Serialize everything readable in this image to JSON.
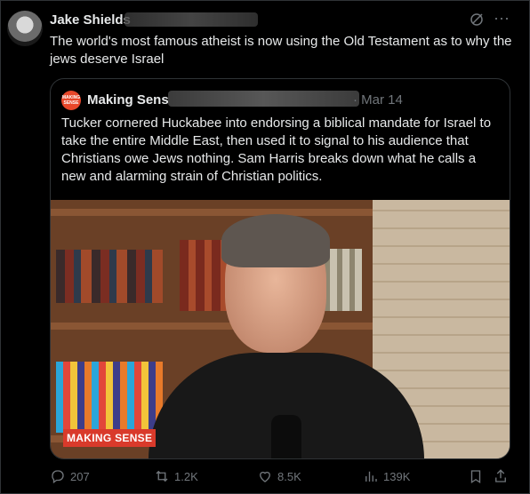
{
  "post": {
    "author_name": "Jake Shields",
    "text": "The world's most famous atheist is now using the Old Testament as to why the jews deserve Israel"
  },
  "quote": {
    "avatar_text": "MAKING SENSE",
    "author_name": "Making Sense",
    "date": "· Mar 14",
    "text": "Tucker cornered Huckabee into endorsing a biblical mandate for Israel to take the entire Middle East, then used it to signal to his audience that Christians owe Jews nothing. Sam Harris breaks down what he calls a new and alarming strain of Christian politics.",
    "video_badge": "MAKING SENSE"
  },
  "actions": {
    "replies": "207",
    "reposts": "1.2K",
    "likes": "8.5K",
    "views": "139K"
  },
  "colors": {
    "background": "#000000",
    "text": "#e7e9ea",
    "muted": "#71767b",
    "border": "#2f3336",
    "brand": "#d93a2b"
  },
  "icons": [
    "grok-icon",
    "more-icon",
    "reply-icon",
    "repost-icon",
    "like-icon",
    "views-icon",
    "bookmark-icon",
    "share-icon"
  ]
}
